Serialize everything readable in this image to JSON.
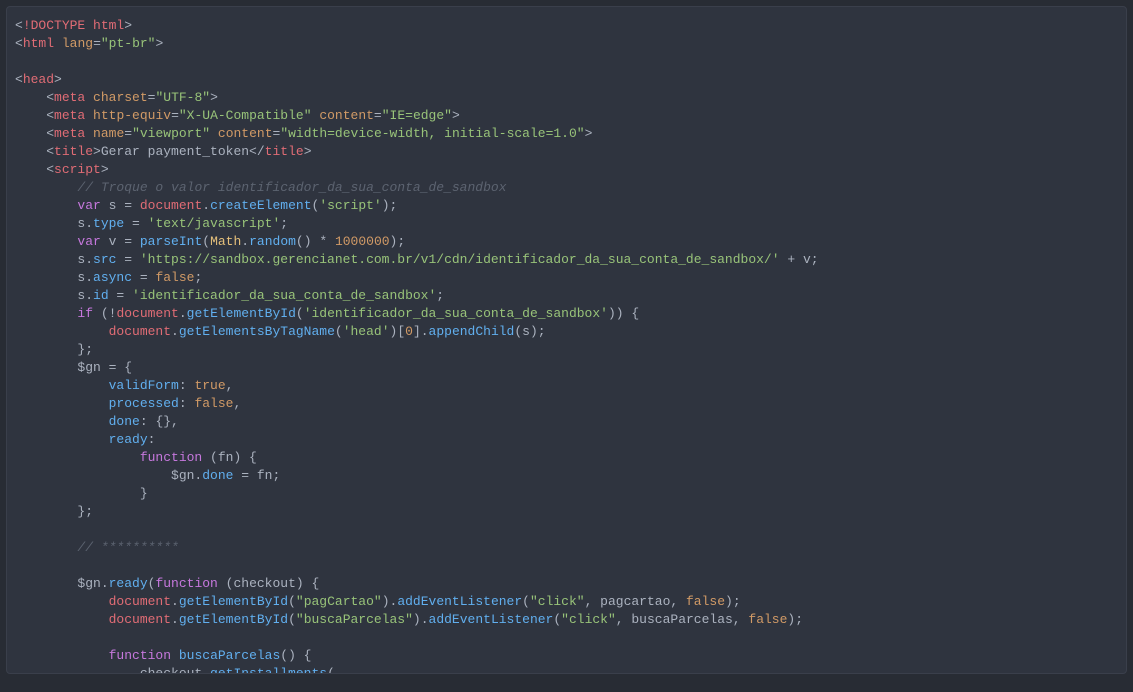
{
  "code": {
    "lines": [
      [
        {
          "c": "t-gray",
          "t": "<"
        },
        {
          "c": "t-red",
          "t": "!DOCTYPE html"
        },
        {
          "c": "t-gray",
          "t": ">"
        }
      ],
      [
        {
          "c": "t-gray",
          "t": "<"
        },
        {
          "c": "t-red",
          "t": "html"
        },
        {
          "c": "t-gray",
          "t": " "
        },
        {
          "c": "t-orange",
          "t": "lang"
        },
        {
          "c": "t-gray",
          "t": "="
        },
        {
          "c": "t-green",
          "t": "\"pt-br\""
        },
        {
          "c": "t-gray",
          "t": ">"
        }
      ],
      [
        {
          "c": "t-gray",
          "t": ""
        }
      ],
      [
        {
          "c": "t-gray",
          "t": "<"
        },
        {
          "c": "t-red",
          "t": "head"
        },
        {
          "c": "t-gray",
          "t": ">"
        }
      ],
      [
        {
          "c": "t-gray",
          "t": "    <"
        },
        {
          "c": "t-red",
          "t": "meta"
        },
        {
          "c": "t-gray",
          "t": " "
        },
        {
          "c": "t-orange",
          "t": "charset"
        },
        {
          "c": "t-gray",
          "t": "="
        },
        {
          "c": "t-green",
          "t": "\"UTF-8\""
        },
        {
          "c": "t-gray",
          "t": ">"
        }
      ],
      [
        {
          "c": "t-gray",
          "t": "    <"
        },
        {
          "c": "t-red",
          "t": "meta"
        },
        {
          "c": "t-gray",
          "t": " "
        },
        {
          "c": "t-orange",
          "t": "http-equiv"
        },
        {
          "c": "t-gray",
          "t": "="
        },
        {
          "c": "t-green",
          "t": "\"X-UA-Compatible\""
        },
        {
          "c": "t-gray",
          "t": " "
        },
        {
          "c": "t-orange",
          "t": "content"
        },
        {
          "c": "t-gray",
          "t": "="
        },
        {
          "c": "t-green",
          "t": "\"IE=edge\""
        },
        {
          "c": "t-gray",
          "t": ">"
        }
      ],
      [
        {
          "c": "t-gray",
          "t": "    <"
        },
        {
          "c": "t-red",
          "t": "meta"
        },
        {
          "c": "t-gray",
          "t": " "
        },
        {
          "c": "t-orange",
          "t": "name"
        },
        {
          "c": "t-gray",
          "t": "="
        },
        {
          "c": "t-green",
          "t": "\"viewport\""
        },
        {
          "c": "t-gray",
          "t": " "
        },
        {
          "c": "t-orange",
          "t": "content"
        },
        {
          "c": "t-gray",
          "t": "="
        },
        {
          "c": "t-green",
          "t": "\"width=device-width, initial-scale=1.0\""
        },
        {
          "c": "t-gray",
          "t": ">"
        }
      ],
      [
        {
          "c": "t-gray",
          "t": "    <"
        },
        {
          "c": "t-red",
          "t": "title"
        },
        {
          "c": "t-gray",
          "t": ">Gerar payment_token</"
        },
        {
          "c": "t-red",
          "t": "title"
        },
        {
          "c": "t-gray",
          "t": ">"
        }
      ],
      [
        {
          "c": "t-gray",
          "t": "    <"
        },
        {
          "c": "t-red",
          "t": "script"
        },
        {
          "c": "t-gray",
          "t": ">"
        }
      ],
      [
        {
          "c": "t-gray",
          "t": "        "
        },
        {
          "c": "t-comment",
          "t": "// Troque o valor identificador_da_sua_conta_de_sandbox"
        }
      ],
      [
        {
          "c": "t-gray",
          "t": "        "
        },
        {
          "c": "t-purple",
          "t": "var"
        },
        {
          "c": "t-gray",
          "t": " s = "
        },
        {
          "c": "t-red",
          "t": "document"
        },
        {
          "c": "t-gray",
          "t": "."
        },
        {
          "c": "t-blue",
          "t": "createElement"
        },
        {
          "c": "t-gray",
          "t": "("
        },
        {
          "c": "t-green",
          "t": "'script'"
        },
        {
          "c": "t-gray",
          "t": ");"
        }
      ],
      [
        {
          "c": "t-gray",
          "t": "        s."
        },
        {
          "c": "t-blue",
          "t": "type"
        },
        {
          "c": "t-gray",
          "t": " = "
        },
        {
          "c": "t-green",
          "t": "'text/javascript'"
        },
        {
          "c": "t-gray",
          "t": ";"
        }
      ],
      [
        {
          "c": "t-gray",
          "t": "        "
        },
        {
          "c": "t-purple",
          "t": "var"
        },
        {
          "c": "t-gray",
          "t": " v = "
        },
        {
          "c": "t-blue",
          "t": "parseInt"
        },
        {
          "c": "t-gray",
          "t": "("
        },
        {
          "c": "t-yellow",
          "t": "Math"
        },
        {
          "c": "t-gray",
          "t": "."
        },
        {
          "c": "t-blue",
          "t": "random"
        },
        {
          "c": "t-gray",
          "t": "() * "
        },
        {
          "c": "t-orange",
          "t": "1000000"
        },
        {
          "c": "t-gray",
          "t": ");"
        }
      ],
      [
        {
          "c": "t-gray",
          "t": "        s."
        },
        {
          "c": "t-blue",
          "t": "src"
        },
        {
          "c": "t-gray",
          "t": " = "
        },
        {
          "c": "t-green",
          "t": "'https://sandbox.gerencianet.com.br/v1/cdn/identificador_da_sua_conta_de_sandbox/'"
        },
        {
          "c": "t-gray",
          "t": " + v;"
        }
      ],
      [
        {
          "c": "t-gray",
          "t": "        s."
        },
        {
          "c": "t-blue",
          "t": "async"
        },
        {
          "c": "t-gray",
          "t": " = "
        },
        {
          "c": "t-orange",
          "t": "false"
        },
        {
          "c": "t-gray",
          "t": ";"
        }
      ],
      [
        {
          "c": "t-gray",
          "t": "        s."
        },
        {
          "c": "t-blue",
          "t": "id"
        },
        {
          "c": "t-gray",
          "t": " = "
        },
        {
          "c": "t-green",
          "t": "'identificador_da_sua_conta_de_sandbox'"
        },
        {
          "c": "t-gray",
          "t": ";"
        }
      ],
      [
        {
          "c": "t-gray",
          "t": "        "
        },
        {
          "c": "t-purple",
          "t": "if"
        },
        {
          "c": "t-gray",
          "t": " (!"
        },
        {
          "c": "t-red",
          "t": "document"
        },
        {
          "c": "t-gray",
          "t": "."
        },
        {
          "c": "t-blue",
          "t": "getElementById"
        },
        {
          "c": "t-gray",
          "t": "("
        },
        {
          "c": "t-green",
          "t": "'identificador_da_sua_conta_de_sandbox'"
        },
        {
          "c": "t-gray",
          "t": ")) {"
        }
      ],
      [
        {
          "c": "t-gray",
          "t": "            "
        },
        {
          "c": "t-red",
          "t": "document"
        },
        {
          "c": "t-gray",
          "t": "."
        },
        {
          "c": "t-blue",
          "t": "getElementsByTagName"
        },
        {
          "c": "t-gray",
          "t": "("
        },
        {
          "c": "t-green",
          "t": "'head'"
        },
        {
          "c": "t-gray",
          "t": ")["
        },
        {
          "c": "t-orange",
          "t": "0"
        },
        {
          "c": "t-gray",
          "t": "]."
        },
        {
          "c": "t-blue",
          "t": "appendChild"
        },
        {
          "c": "t-gray",
          "t": "(s);"
        }
      ],
      [
        {
          "c": "t-gray",
          "t": "        };"
        }
      ],
      [
        {
          "c": "t-gray",
          "t": "        $gn = {"
        }
      ],
      [
        {
          "c": "t-gray",
          "t": "            "
        },
        {
          "c": "t-blue",
          "t": "validForm"
        },
        {
          "c": "t-gray",
          "t": ": "
        },
        {
          "c": "t-orange",
          "t": "true"
        },
        {
          "c": "t-gray",
          "t": ","
        }
      ],
      [
        {
          "c": "t-gray",
          "t": "            "
        },
        {
          "c": "t-blue",
          "t": "processed"
        },
        {
          "c": "t-gray",
          "t": ": "
        },
        {
          "c": "t-orange",
          "t": "false"
        },
        {
          "c": "t-gray",
          "t": ","
        }
      ],
      [
        {
          "c": "t-gray",
          "t": "            "
        },
        {
          "c": "t-blue",
          "t": "done"
        },
        {
          "c": "t-gray",
          "t": ": {},"
        }
      ],
      [
        {
          "c": "t-gray",
          "t": "            "
        },
        {
          "c": "t-blue",
          "t": "ready"
        },
        {
          "c": "t-gray",
          "t": ":"
        }
      ],
      [
        {
          "c": "t-gray",
          "t": "                "
        },
        {
          "c": "t-purple",
          "t": "function"
        },
        {
          "c": "t-gray",
          "t": " (fn) {"
        }
      ],
      [
        {
          "c": "t-gray",
          "t": "                    $gn."
        },
        {
          "c": "t-blue",
          "t": "done"
        },
        {
          "c": "t-gray",
          "t": " = fn;"
        }
      ],
      [
        {
          "c": "t-gray",
          "t": "                }"
        }
      ],
      [
        {
          "c": "t-gray",
          "t": "        };"
        }
      ],
      [
        {
          "c": "t-gray",
          "t": ""
        }
      ],
      [
        {
          "c": "t-gray",
          "t": "        "
        },
        {
          "c": "t-comment",
          "t": "// **********"
        }
      ],
      [
        {
          "c": "t-gray",
          "t": ""
        }
      ],
      [
        {
          "c": "t-gray",
          "t": "        $gn."
        },
        {
          "c": "t-blue",
          "t": "ready"
        },
        {
          "c": "t-gray",
          "t": "("
        },
        {
          "c": "t-purple",
          "t": "function"
        },
        {
          "c": "t-gray",
          "t": " (checkout) {"
        }
      ],
      [
        {
          "c": "t-gray",
          "t": "            "
        },
        {
          "c": "t-red",
          "t": "document"
        },
        {
          "c": "t-gray",
          "t": "."
        },
        {
          "c": "t-blue",
          "t": "getElementById"
        },
        {
          "c": "t-gray",
          "t": "("
        },
        {
          "c": "t-green",
          "t": "\"pagCartao\""
        },
        {
          "c": "t-gray",
          "t": ")."
        },
        {
          "c": "t-blue",
          "t": "addEventListener"
        },
        {
          "c": "t-gray",
          "t": "("
        },
        {
          "c": "t-green",
          "t": "\"click\""
        },
        {
          "c": "t-gray",
          "t": ", pagcartao, "
        },
        {
          "c": "t-orange",
          "t": "false"
        },
        {
          "c": "t-gray",
          "t": ");"
        }
      ],
      [
        {
          "c": "t-gray",
          "t": "            "
        },
        {
          "c": "t-red",
          "t": "document"
        },
        {
          "c": "t-gray",
          "t": "."
        },
        {
          "c": "t-blue",
          "t": "getElementById"
        },
        {
          "c": "t-gray",
          "t": "("
        },
        {
          "c": "t-green",
          "t": "\"buscaParcelas\""
        },
        {
          "c": "t-gray",
          "t": ")."
        },
        {
          "c": "t-blue",
          "t": "addEventListener"
        },
        {
          "c": "t-gray",
          "t": "("
        },
        {
          "c": "t-green",
          "t": "\"click\""
        },
        {
          "c": "t-gray",
          "t": ", buscaParcelas, "
        },
        {
          "c": "t-orange",
          "t": "false"
        },
        {
          "c": "t-gray",
          "t": ");"
        }
      ],
      [
        {
          "c": "t-gray",
          "t": ""
        }
      ],
      [
        {
          "c": "t-gray",
          "t": "            "
        },
        {
          "c": "t-purple",
          "t": "function"
        },
        {
          "c": "t-gray",
          "t": " "
        },
        {
          "c": "t-blue",
          "t": "buscaParcelas"
        },
        {
          "c": "t-gray",
          "t": "() {"
        }
      ],
      [
        {
          "c": "t-gray",
          "t": "                checkout."
        },
        {
          "c": "t-blue",
          "t": "getInstallments"
        },
        {
          "c": "t-gray",
          "t": "("
        }
      ]
    ]
  }
}
